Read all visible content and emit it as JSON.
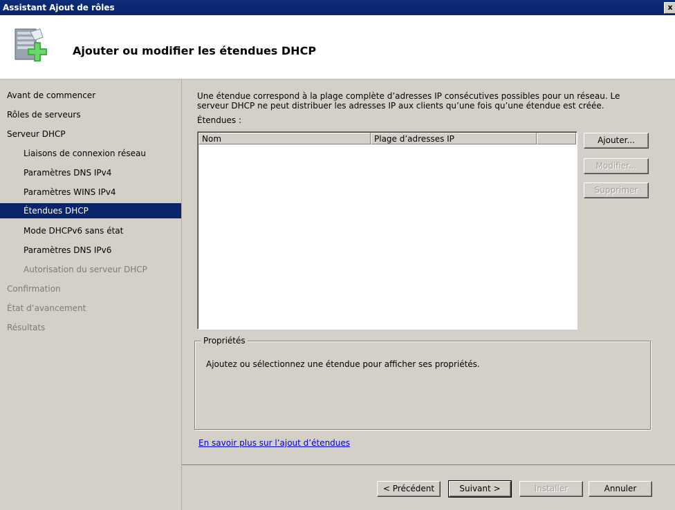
{
  "window": {
    "title": "Assistant Ajout de rôles",
    "close_glyph": "x"
  },
  "header": {
    "title": "Ajouter ou modifier les étendues DHCP",
    "icon": "server-add-icon"
  },
  "nav": {
    "items": [
      {
        "label": "Avant de commencer",
        "state": "normal"
      },
      {
        "label": "Rôles de serveurs",
        "state": "normal"
      },
      {
        "label": "Serveur DHCP",
        "state": "normal"
      },
      {
        "label": "Liaisons de connexion réseau",
        "state": "normal",
        "sub": true
      },
      {
        "label": "Paramètres DNS IPv4",
        "state": "normal",
        "sub": true
      },
      {
        "label": "Paramètres WINS IPv4",
        "state": "normal",
        "sub": true
      },
      {
        "label": "Étendues DHCP",
        "state": "selected",
        "sub": true
      },
      {
        "label": "Mode DHCPv6 sans état",
        "state": "normal",
        "sub": true
      },
      {
        "label": "Paramètres DNS IPv6",
        "state": "normal",
        "sub": true
      },
      {
        "label": "Autorisation du serveur DHCP",
        "state": "disabled",
        "sub": true
      },
      {
        "label": "Confirmation",
        "state": "disabled"
      },
      {
        "label": "État d’avancement",
        "state": "disabled"
      },
      {
        "label": "Résultats",
        "state": "disabled"
      }
    ]
  },
  "main": {
    "description": "Une étendue correspond à la plage complète d’adresses IP consécutives possibles pour un réseau. Le serveur DHCP ne peut distribuer les adresses IP aux clients qu’une fois qu’une étendue est créée.",
    "scopes_label": "Étendues :",
    "columns": [
      "Nom",
      "Plage d’adresses IP",
      ""
    ],
    "rows": [],
    "side_buttons": {
      "add": "Ajouter...",
      "modify": "Modifier...",
      "delete": "Supprimer"
    },
    "properties": {
      "legend": "Propriétés",
      "message": "Ajoutez ou sélectionnez une étendue pour afficher ses propriétés."
    },
    "learn_more_link": "En savoir plus sur l’ajout d’étendues"
  },
  "footer": {
    "previous": "< Précédent",
    "next": "Suivant >",
    "install": "Installer",
    "cancel": "Annuler"
  },
  "colors": {
    "titlebar": "#0a246a",
    "selection": "#0a246a",
    "face": "#d4d0c8",
    "link": "#0000cc"
  }
}
